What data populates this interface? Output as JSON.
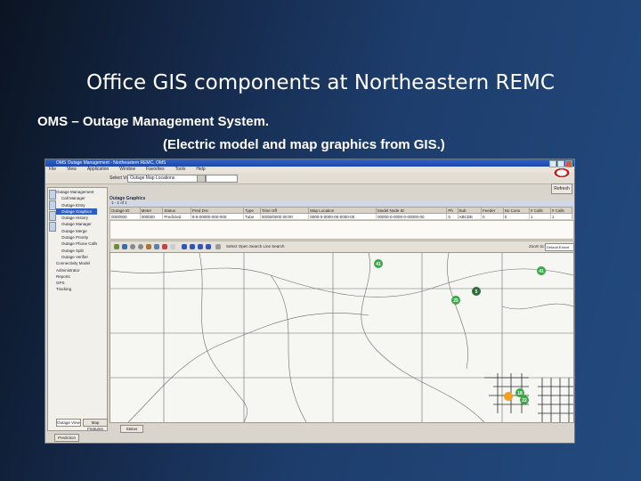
{
  "slide": {
    "title": "Office GIS components at Northeastern REMC",
    "subtitle_line1": "OMS – Outage Management System.",
    "subtitle_line2": "(Electric model and map graphics from GIS.)"
  },
  "window": {
    "title": "OMS Outage Management - Northeastern REMC, OMS",
    "menu": [
      "File",
      "View",
      "Application",
      "Window",
      "Favorites",
      "Tools",
      "Help"
    ],
    "toolbar_label": "Select View:",
    "toolbar_select": "Outage Map Locations",
    "refresh_label": "Refresh",
    "prediction_label": "Prediction",
    "status_button": "Status"
  },
  "sidebar": {
    "items": [
      {
        "label": "Outage Management",
        "selected": false
      },
      {
        "label": "Call Manager",
        "selected": false
      },
      {
        "label": "Outage Entry",
        "selected": false
      },
      {
        "label": "Outage Graphics",
        "selected": true
      },
      {
        "label": "Outage History",
        "selected": false
      },
      {
        "label": "Outage Manager",
        "selected": false
      },
      {
        "label": "Outage Merge",
        "selected": false
      },
      {
        "label": "Outage Priority",
        "selected": false
      },
      {
        "label": "Outage Phone Calls",
        "selected": false
      },
      {
        "label": "Outage Split",
        "selected": false
      },
      {
        "label": "Outage Verifier",
        "selected": false
      },
      {
        "label": "Connectivity Model",
        "selected": false
      },
      {
        "label": "Administrator",
        "selected": false
      },
      {
        "label": "Reports",
        "selected": false
      },
      {
        "label": "GPS",
        "selected": false
      },
      {
        "label": "Tracking",
        "selected": false
      }
    ],
    "tabs": [
      "Outage View",
      "Map Features"
    ]
  },
  "grid": {
    "panel_title": "Outage Graphics",
    "subtab": "1 - 1 of 1",
    "columns": [
      "Outage ID",
      "Meter",
      "Status",
      "Pred Dvc",
      "Type",
      "Time Off",
      "Map Location",
      "Model Node ID",
      "Ph",
      "Sub",
      "Feeder",
      "No Cons",
      "# Calls",
      "# Calls"
    ],
    "rows": [
      [
        "0000000",
        "000000",
        "Predicted",
        "8-8-00000-000-000",
        "Tube",
        "00/00/0000 00:00",
        "0000-0-0000-00-0000-00",
        "00000-0-0000-0-00000-00",
        "0",
        "ABCDE",
        "0",
        "0",
        "1",
        "1"
      ]
    ]
  },
  "maptools": {
    "label": "Select Open Search Line Search",
    "zoom_label": "Zoom to:",
    "zoom_value": "Default Extent"
  },
  "map": {
    "pins": [
      {
        "label": "41",
        "color": "#3aa846"
      },
      {
        "label": "41",
        "color": "#3aa846"
      },
      {
        "label": "5",
        "color": "#2f6d3a"
      },
      {
        "label": "25",
        "color": "#3aa846"
      },
      {
        "label": "18",
        "color": "#3aa846"
      },
      {
        "label": "22",
        "color": "#3aa846"
      },
      {
        "label": "",
        "color": "#f2a11e"
      }
    ]
  },
  "colors": {
    "background_dark": "#0b1422",
    "background_light": "#234a7e",
    "titlebar": "#2f63c9",
    "selected_item": "#2e5ec4"
  }
}
